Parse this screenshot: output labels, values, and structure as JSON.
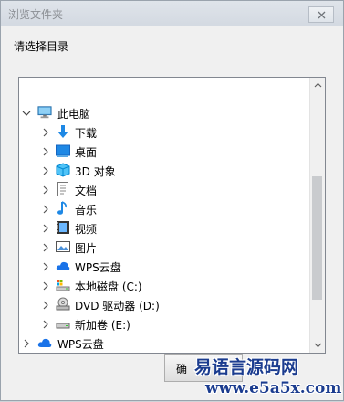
{
  "window": {
    "title": "浏览文件夹"
  },
  "prompt": "请选择目录",
  "tree": {
    "root": {
      "label": "此电脑",
      "icon": "pc-monitor-icon",
      "expanded": true
    },
    "children": [
      {
        "label": "下载",
        "icon": "download-arrow-icon"
      },
      {
        "label": "桌面",
        "icon": "desktop-icon"
      },
      {
        "label": "3D 对象",
        "icon": "3d-objects-icon"
      },
      {
        "label": "文档",
        "icon": "document-icon"
      },
      {
        "label": "音乐",
        "icon": "music-note-icon"
      },
      {
        "label": "视频",
        "icon": "video-icon"
      },
      {
        "label": "图片",
        "icon": "picture-icon"
      },
      {
        "label": "WPS云盘",
        "icon": "cloud-icon"
      },
      {
        "label": "本地磁盘 (C:)",
        "icon": "local-disk-icon"
      },
      {
        "label": "DVD 驱动器 (D:)",
        "icon": "dvd-drive-icon"
      },
      {
        "label": "新加卷 (E:)",
        "icon": "drive-icon"
      }
    ],
    "sibling": {
      "label": "WPS云盘",
      "icon": "cloud-icon"
    }
  },
  "ok_button": {
    "label": "确"
  },
  "watermark": {
    "line1": "易语言源码网",
    "line2": "www.e5a5x.com"
  },
  "colors": {
    "accent_blue": "#1e88e5",
    "cloud_blue": "#1a73e8"
  }
}
